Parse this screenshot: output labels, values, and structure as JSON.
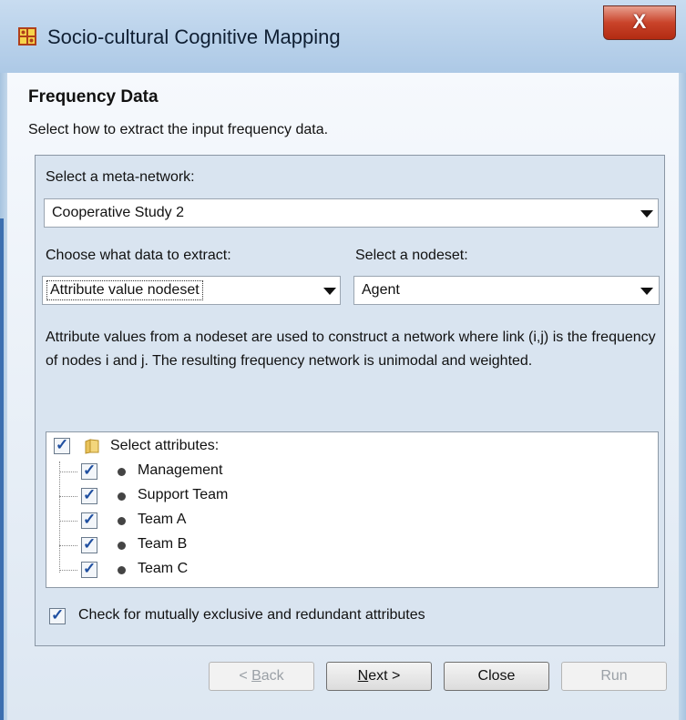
{
  "window": {
    "title": "Socio-cultural Cognitive Mapping",
    "close_glyph": "X"
  },
  "page": {
    "heading": "Frequency Data",
    "subheading": "Select how to extract the input frequency data."
  },
  "form": {
    "meta_network_label": "Select a meta-network:",
    "meta_network_value": "Cooperative Study 2",
    "extract_label": "Choose what data to extract:",
    "extract_value": "Attribute value nodeset",
    "nodeset_label": "Select a nodeset:",
    "nodeset_value": "Agent",
    "description": "Attribute values from a nodeset are used to construct a network where link (i,j) is the frequency of nodes i and j. The resulting frequency network is unimodal and weighted."
  },
  "tree": {
    "root_label": "Select attributes:",
    "root_checked": true,
    "items": [
      {
        "label": "Management",
        "checked": true
      },
      {
        "label": "Support Team",
        "checked": true
      },
      {
        "label": "Team A",
        "checked": true
      },
      {
        "label": "Team B",
        "checked": true
      },
      {
        "label": "Team C",
        "checked": true
      }
    ]
  },
  "options": {
    "exclusive_check_label": "Check for mutually exclusive and redundant attributes",
    "exclusive_checked": true
  },
  "buttons": {
    "back": {
      "prefix": "< ",
      "mnemonic": "B",
      "rest": "ack",
      "enabled": false
    },
    "next": {
      "mnemonic": "N",
      "rest": "ext >",
      "enabled": true
    },
    "close": {
      "label": "Close",
      "enabled": true
    },
    "run": {
      "label": "Run",
      "enabled": false
    }
  },
  "colors": {
    "title_bg": "#adc9e6",
    "panel_bg": "#d9e4f0",
    "close_red": "#c9432a",
    "checkmark": "#1f4fa0"
  },
  "icons": [
    "app-icon",
    "close-icon",
    "dropdown-arrow-icon",
    "folder-icon",
    "bullet-icon",
    "checkbox-icon"
  ]
}
